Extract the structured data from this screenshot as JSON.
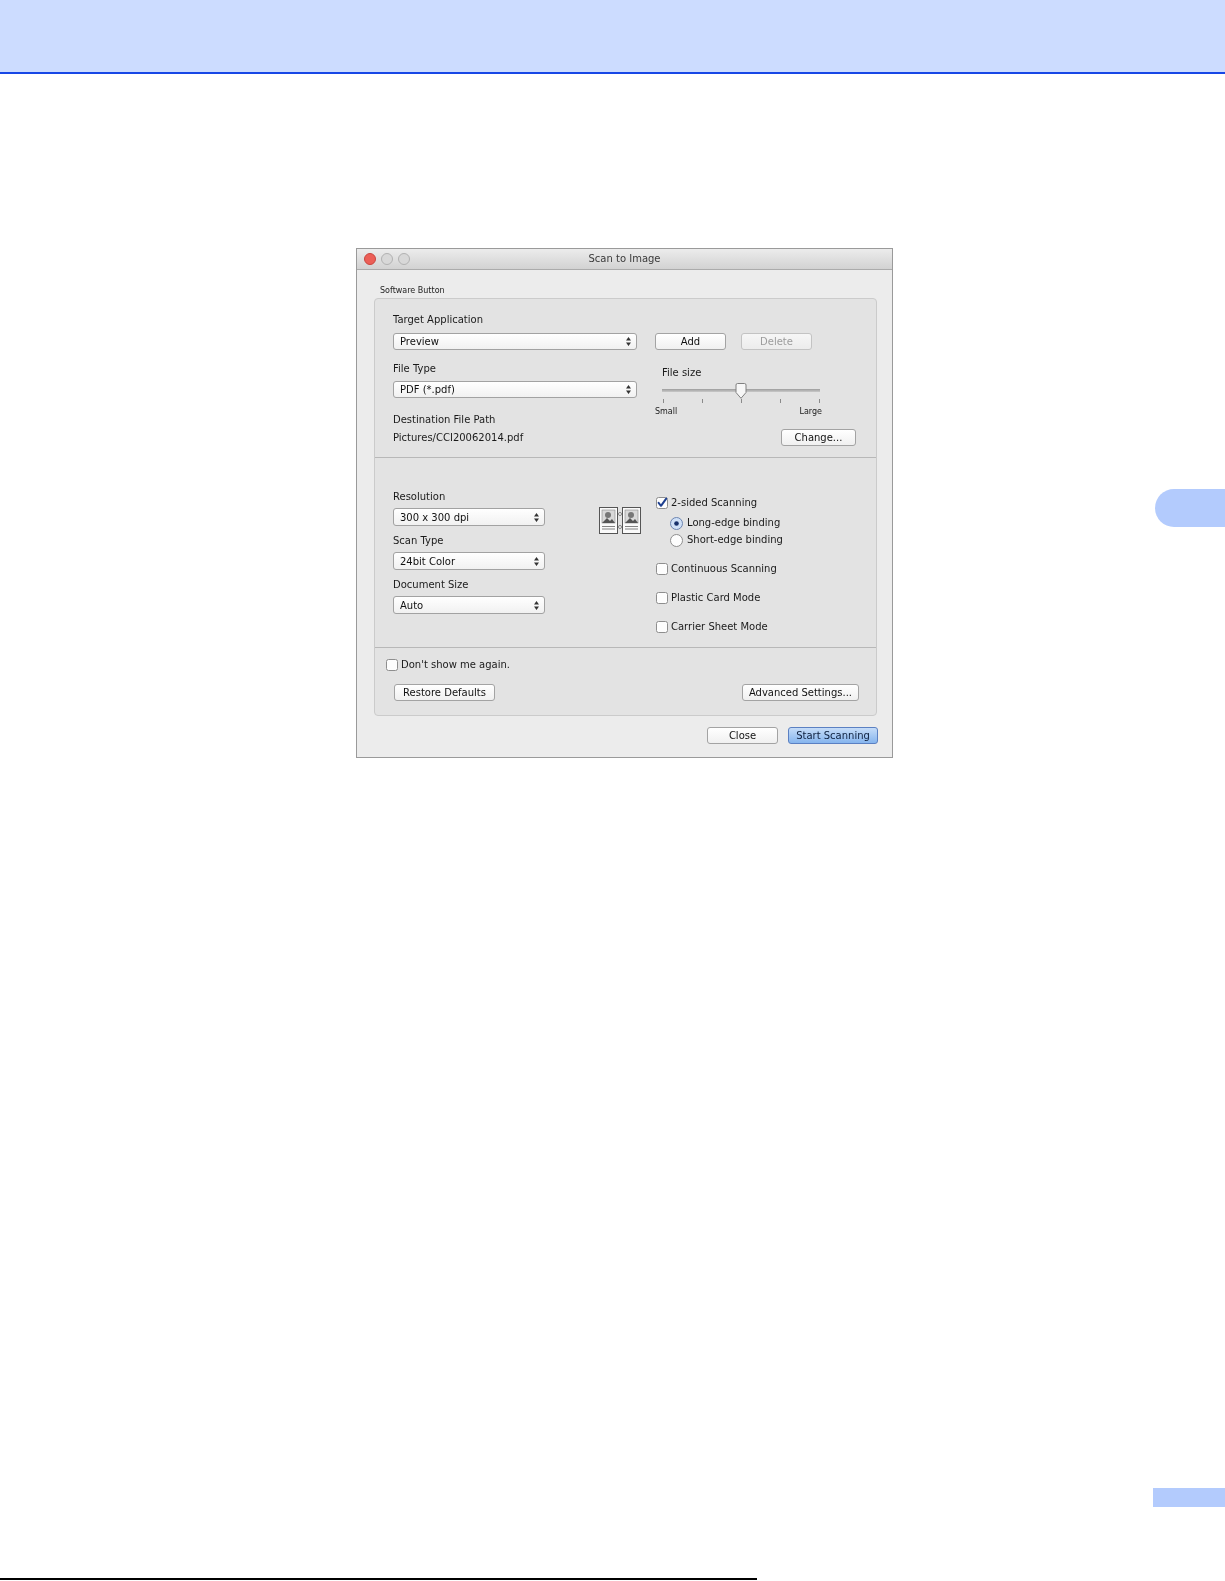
{
  "window": {
    "title": "Scan to Image",
    "controls": [
      {
        "kind": "close",
        "disabled": false
      },
      {
        "kind": "minimize",
        "disabled": true
      },
      {
        "kind": "zoom",
        "disabled": true
      }
    ]
  },
  "group": {
    "title": "Software Button"
  },
  "target_application": {
    "label": "Target Application",
    "value": "Preview",
    "buttons": [
      {
        "label": "Add",
        "disabled": false
      },
      {
        "label": "Delete",
        "disabled": true
      }
    ]
  },
  "file_type": {
    "label": "File Type",
    "value": "PDF (*.pdf)"
  },
  "file_size": {
    "label": "File size",
    "level": 0.5,
    "min_label": "Small",
    "max_label": "Large"
  },
  "destination": {
    "label": "Destination File Path",
    "path": "Pictures/CCI20062014.pdf",
    "button": "Change..."
  },
  "scan_settings": [
    {
      "label": "Resolution",
      "value": "300 x 300 dpi"
    },
    {
      "label": "Scan Type",
      "value": "24bit Color"
    },
    {
      "label": "Document Size",
      "value": "Auto"
    }
  ],
  "options": [
    {
      "label": "2-sided Scanning",
      "checked": true,
      "bindings": [
        {
          "label": "Long-edge binding",
          "selected": true
        },
        {
          "label": "Short-edge binding",
          "selected": false
        }
      ]
    },
    {
      "label": "Continuous Scanning",
      "checked": false
    },
    {
      "label": "Plastic Card Mode",
      "checked": false
    },
    {
      "label": "Carrier Sheet Mode",
      "checked": false
    }
  ],
  "dont_show_again": {
    "label": "Don't show me again.",
    "checked": false
  },
  "panel_buttons": [
    "Restore Defaults",
    "Advanced Settings..."
  ],
  "dialog_buttons": [
    {
      "label": "Close",
      "default": false
    },
    {
      "label": "Start Scanning",
      "default": true
    }
  ]
}
